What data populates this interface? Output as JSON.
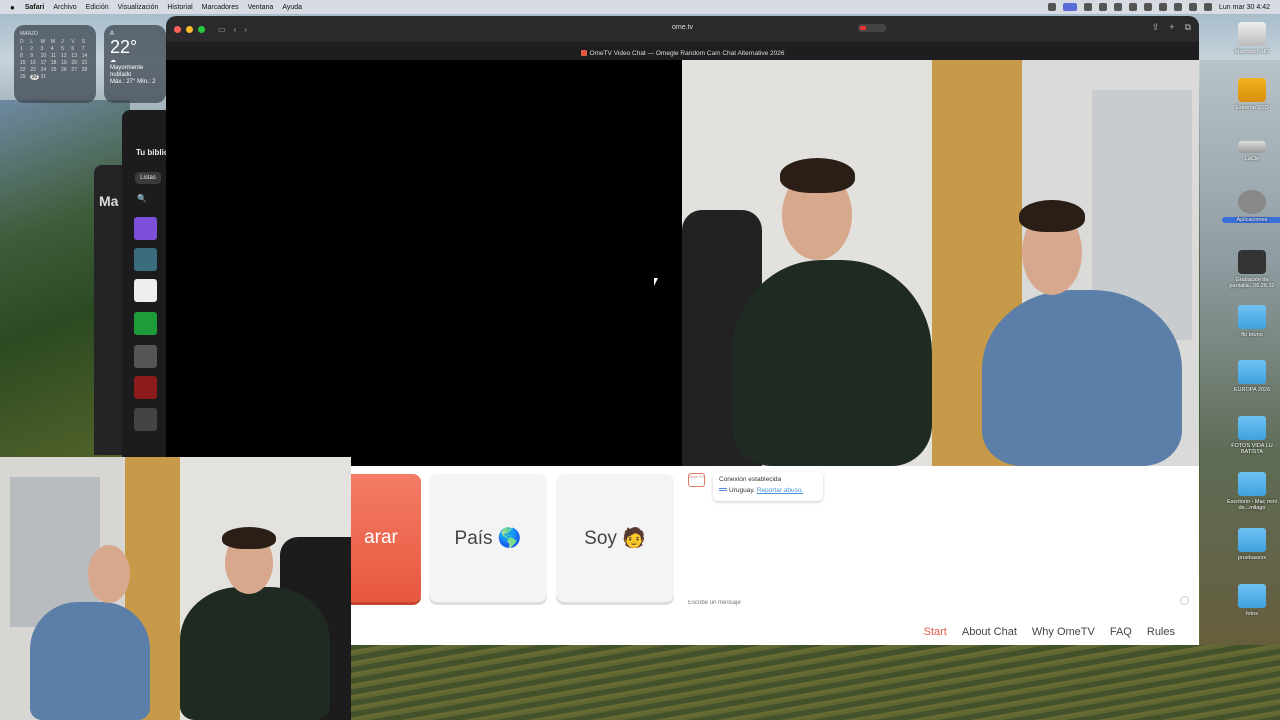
{
  "menubar": {
    "apple": "",
    "items": [
      "Safari",
      "Archivo",
      "Edición",
      "Visualización",
      "Historial",
      "Marcadores",
      "Ventana",
      "Ayuda"
    ],
    "clock": "Lun mar 30 4:42"
  },
  "calendar_widget": {
    "month": "MARZO",
    "day_headers": [
      "D",
      "L",
      "M",
      "M",
      "J",
      "V",
      "S"
    ],
    "days": [
      "1",
      "2",
      "3",
      "4",
      "5",
      "6",
      "7",
      "8",
      "9",
      "10",
      "11",
      "12",
      "13",
      "14",
      "15",
      "16",
      "17",
      "18",
      "19",
      "20",
      "21",
      "22",
      "23",
      "24",
      "25",
      "26",
      "27",
      "28",
      "29",
      "30",
      "31"
    ],
    "today": "30"
  },
  "weather_widget": {
    "location": "A",
    "temperature": "22°",
    "condition_line1": "Mayormente",
    "condition_line2": "nublado",
    "range": "Máx.: 27° Mín.: 2"
  },
  "music_window": {
    "title": "Tu bibliote",
    "partial_title": "Ma",
    "lists_label": "Listas",
    "search_icon": "🔍"
  },
  "browser": {
    "url": "ome.tv",
    "tab_title": "OmeTV Video Chat — Omegle Random Cam Chat Alternative 2026",
    "toolbar_icons": {
      "sidebar": "▭",
      "back": "‹",
      "forward": "›",
      "share": "⇪",
      "new_tab": "+",
      "tabs": "⧉"
    }
  },
  "progress": {
    "fill_fraction": 0.96
  },
  "controls": {
    "stop_label": "arar",
    "country_label": "País 🌎",
    "gender_label": "Soy 🧑"
  },
  "chat": {
    "avatar_text": "Ome TV",
    "system_message": "Conexión establecida",
    "country": "Uruguay.",
    "report_link": "Reportar abuso.",
    "input_placeholder": "Escribe un mensaje"
  },
  "footer": {
    "links": [
      "Start",
      "About Chat",
      "Why OmeTV",
      "FAQ",
      "Rules"
    ],
    "active": "Start"
  },
  "desktop_icons": [
    {
      "label": "Macintosh HD",
      "kind": "disk"
    },
    {
      "label": "Extreme SSD",
      "kind": "ext"
    },
    {
      "label": "LaCie",
      "kind": "lacie"
    },
    {
      "label": "Aplicaciones",
      "kind": "apps"
    },
    {
      "label": "Grabación de pantalla...06.26.32",
      "kind": "vid"
    },
    {
      "label": "flo bruno",
      "kind": "folder"
    },
    {
      "label": "EUROPA 2026",
      "kind": "folder"
    },
    {
      "label": "FOTOS VIDA LU BATISTA",
      "kind": "folder"
    },
    {
      "label": "Escritorio - Mac mini de...milago",
      "kind": "folder"
    },
    {
      "label": "pruebasxxx",
      "kind": "folder"
    },
    {
      "label": "fotos",
      "kind": "folder"
    }
  ],
  "colors": {
    "brand": "#e25b45",
    "progress": "#5dd3a8",
    "link": "#4a90d9"
  }
}
